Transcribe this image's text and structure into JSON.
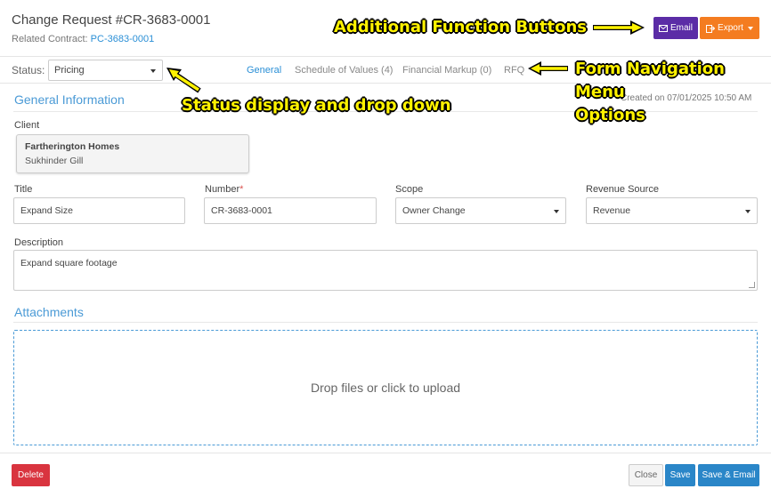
{
  "header": {
    "title": "Change Request #CR-3683-0001",
    "related_label": "Related Contract:",
    "related_link": "PC-3683-0001",
    "email_button": "Email",
    "export_button": "Export"
  },
  "status": {
    "label": "Status:",
    "value": "Pricing"
  },
  "nav_tabs": [
    "General",
    "Schedule of Values (4)",
    "Financial Markup (0)",
    "RFQ"
  ],
  "general": {
    "section_title": "General Information",
    "created_text": "Created on 07/01/2025 10:50 AM",
    "client_label": "Client",
    "client_name": "Fartherington Homes",
    "client_contact": "Sukhinder Gill",
    "title_label": "Title",
    "title_value": "Expand Size",
    "number_label": "Number",
    "number_required": "*",
    "number_value": "CR-3683-0001",
    "scope_label": "Scope",
    "scope_value": "Owner Change",
    "revenue_label": "Revenue Source",
    "revenue_value": "Revenue",
    "description_label": "Description",
    "description_value": "Expand square footage"
  },
  "attachments": {
    "section_title": "Attachments",
    "dropzone_text": "Drop files or click to upload"
  },
  "footer": {
    "delete": "Delete",
    "close": "Close",
    "save": "Save",
    "save_email": "Save & Email"
  },
  "annotations": {
    "function_buttons": "Additional Function Buttons",
    "form_nav_line1": "Form Navigation",
    "form_nav_line2": "Menu",
    "form_nav_line3": "Options",
    "status_dropdown": "Status display and drop down"
  },
  "colors": {
    "accent_blue": "#2a8fd6",
    "email_purple": "#5b2ca6",
    "export_orange": "#f47c20",
    "delete_red": "#d9343f",
    "annotation_yellow": "#fff200"
  },
  "icons": {
    "email": "envelope-icon",
    "export": "export-icon",
    "status_dropdown": "caret-down-icon"
  }
}
